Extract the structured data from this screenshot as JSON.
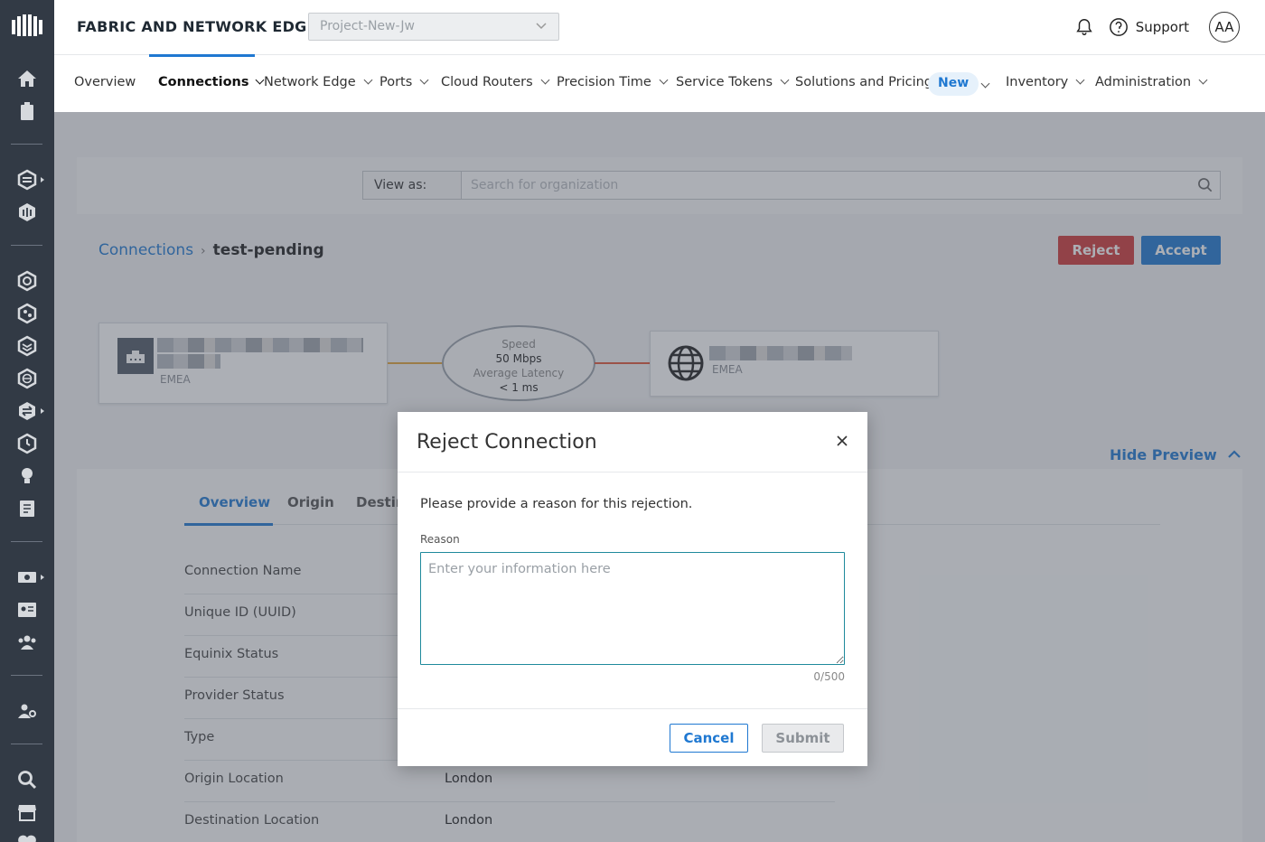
{
  "header": {
    "brand": "FABRIC AND NETWORK EDGE",
    "project": "Project-New-Jw",
    "support": "Support",
    "avatar": "AA"
  },
  "nav": {
    "items": [
      {
        "label": "Overview"
      },
      {
        "label": "Connections"
      },
      {
        "label": "Network Edge"
      },
      {
        "label": "Ports"
      },
      {
        "label": "Cloud Routers"
      },
      {
        "label": "Precision Time"
      },
      {
        "label": "Service Tokens"
      },
      {
        "label": "Solutions and Pricing"
      },
      {
        "label": "Inventory"
      },
      {
        "label": "Administration"
      }
    ],
    "new_badge": "New"
  },
  "rail": {
    "icons": [
      "logo-icon",
      "home-icon",
      "clipboard-icon",
      "layers-icon",
      "network-edge-icon",
      "hexagon-icon",
      "node-icon",
      "stack-icon",
      "globe-icon",
      "transfer-icon",
      "clock-icon",
      "lightbulb-icon",
      "document-icon",
      "billing-icon",
      "id-card-icon",
      "users-icon",
      "user-settings-icon",
      "search-icon",
      "store-icon",
      "heart-icon"
    ]
  },
  "viewas": {
    "label": "View as:",
    "placeholder": "Search for organization"
  },
  "breadcrumb": {
    "parent": "Connections",
    "separator": "›",
    "current": "test-pending"
  },
  "actions": {
    "reject": "Reject",
    "accept": "Accept"
  },
  "diagram": {
    "origin_region": "EMEA",
    "destination_region": "EMEA",
    "speed_label": "Speed",
    "speed_value": "50 Mbps",
    "latency_label": "Average Latency",
    "latency_value": "< 1 ms",
    "origin_line_color": "#e0a23a",
    "destination_line_color": "#e0573a"
  },
  "preview": {
    "hide_label": "Hide Preview"
  },
  "tabs": [
    {
      "label": "Overview"
    },
    {
      "label": "Origin"
    },
    {
      "label": "Destin"
    }
  ],
  "details": [
    {
      "key": "Connection Name",
      "value": ""
    },
    {
      "key": "Unique ID (UUID)",
      "value": ""
    },
    {
      "key": "Equinix Status",
      "value": ""
    },
    {
      "key": "Provider Status",
      "value": ""
    },
    {
      "key": "Type",
      "value": ""
    },
    {
      "key": "Origin Location",
      "value": "London"
    },
    {
      "key": "Destination Location",
      "value": "London"
    }
  ],
  "modal": {
    "title": "Reject Connection",
    "description": "Please provide a reason for this rejection.",
    "reason_label": "Reason",
    "reason_placeholder": "Enter your information here",
    "reason_value": "",
    "counter": "0/500",
    "cancel": "Cancel",
    "submit": "Submit"
  },
  "colors": {
    "accent": "#1f78d1",
    "danger": "#d03a3a",
    "rail": "#323a45"
  }
}
